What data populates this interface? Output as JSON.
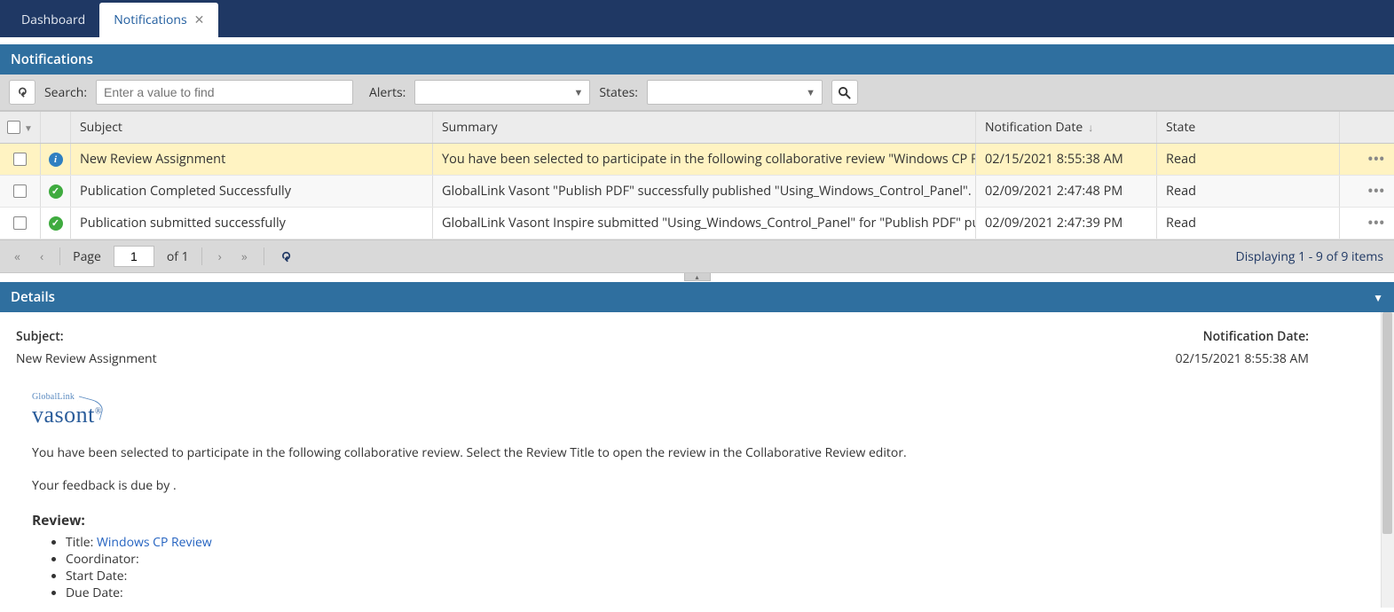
{
  "tabs": {
    "dashboard": "Dashboard",
    "notifications": "Notifications"
  },
  "panel": {
    "title": "Notifications"
  },
  "toolbar": {
    "search_label": "Search:",
    "search_placeholder": "Enter a value to find",
    "alerts_label": "Alerts:",
    "states_label": "States:"
  },
  "columns": {
    "subject": "Subject",
    "summary": "Summary",
    "date": "Notification Date",
    "state": "State"
  },
  "rows": [
    {
      "icon": "info",
      "subject": "New Review Assignment",
      "summary": "You have been selected to participate in the following collaborative review \"Windows CP Re...",
      "date": "02/15/2021 8:55:38 AM",
      "state": "Read",
      "selected": true
    },
    {
      "icon": "success",
      "subject": "Publication Completed Successfully",
      "summary": "GlobalLink Vasont \"Publish PDF\" successfully published \"Using_Windows_Control_Panel\". R...",
      "date": "02/09/2021 2:47:48 PM",
      "state": "Read",
      "selected": false
    },
    {
      "icon": "success",
      "subject": "Publication submitted successfully",
      "summary": "GlobalLink Vasont Inspire submitted \"Using_Windows_Control_Panel\" for \"Publish PDF\" pu...",
      "date": "02/09/2021 2:47:39 PM",
      "state": "Read",
      "selected": false
    }
  ],
  "paging": {
    "page_label": "Page",
    "page_value": "1",
    "of_label": "of 1",
    "status": "Displaying 1 - 9 of 9 items"
  },
  "details": {
    "header": "Details",
    "subject_label": "Subject:",
    "subject_value": "New Review Assignment",
    "date_label": "Notification Date:",
    "date_value": "02/15/2021 8:55:38 AM",
    "logo_top": "GlobalLink",
    "logo_main": "vasont",
    "intro": "You have been selected to participate in the following collaborative review. Select the Review Title to open the review in the Collaborative Review editor.",
    "feedback": "Your feedback is due by .",
    "review_heading": "Review:",
    "review": {
      "title_label": "Title: ",
      "title_link": "Windows CP Review",
      "coordinator_label": "Coordinator:",
      "start_label": "Start Date:",
      "due_label": "Due Date:"
    }
  }
}
